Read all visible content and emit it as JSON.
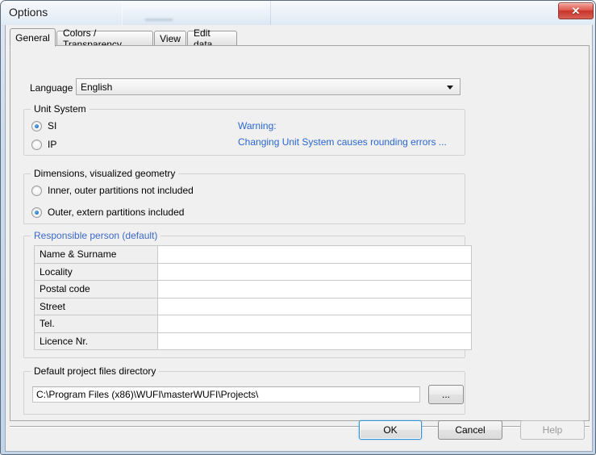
{
  "window": {
    "title": "Options",
    "close_label": "✕"
  },
  "tabs": [
    {
      "label": "General",
      "active": true
    },
    {
      "label": "Colors / Transparency",
      "active": false
    },
    {
      "label": "View",
      "active": false
    },
    {
      "label": "Edit data",
      "active": false
    }
  ],
  "language": {
    "label": "Language",
    "selected": "English",
    "arrow_icon": "chevron-down-icon"
  },
  "unit_system": {
    "legend": "Unit System",
    "options": [
      {
        "label": "SI",
        "checked": true
      },
      {
        "label": "IP",
        "checked": false
      }
    ],
    "warning_title": "Warning:",
    "warning_text": "Changing Unit System causes rounding errors ...",
    "warning_color": "#2a67cf"
  },
  "dimensions": {
    "legend": "Dimensions, visualized geometry",
    "options": [
      {
        "label": "Inner, outer partitions not included",
        "checked": false
      },
      {
        "label": "Outer, extern partitions included",
        "checked": true
      }
    ]
  },
  "responsible_person": {
    "legend": "Responsible person (default)",
    "legend_color": "#3b68c8",
    "rows": [
      {
        "label": "Name & Surname",
        "value": ""
      },
      {
        "label": "Locality",
        "value": ""
      },
      {
        "label": "Postal code",
        "value": ""
      },
      {
        "label": "Street",
        "value": ""
      },
      {
        "label": "Tel.",
        "value": ""
      },
      {
        "label": "Licence Nr.",
        "value": ""
      }
    ]
  },
  "project_dir": {
    "legend": "Default project files directory",
    "path": "C:\\Program Files (x86)\\WUFI\\masterWUFI\\Projects\\",
    "browse_label": "..."
  },
  "footer": {
    "ok_label": "OK",
    "cancel_label": "Cancel",
    "help_label": "Help"
  }
}
